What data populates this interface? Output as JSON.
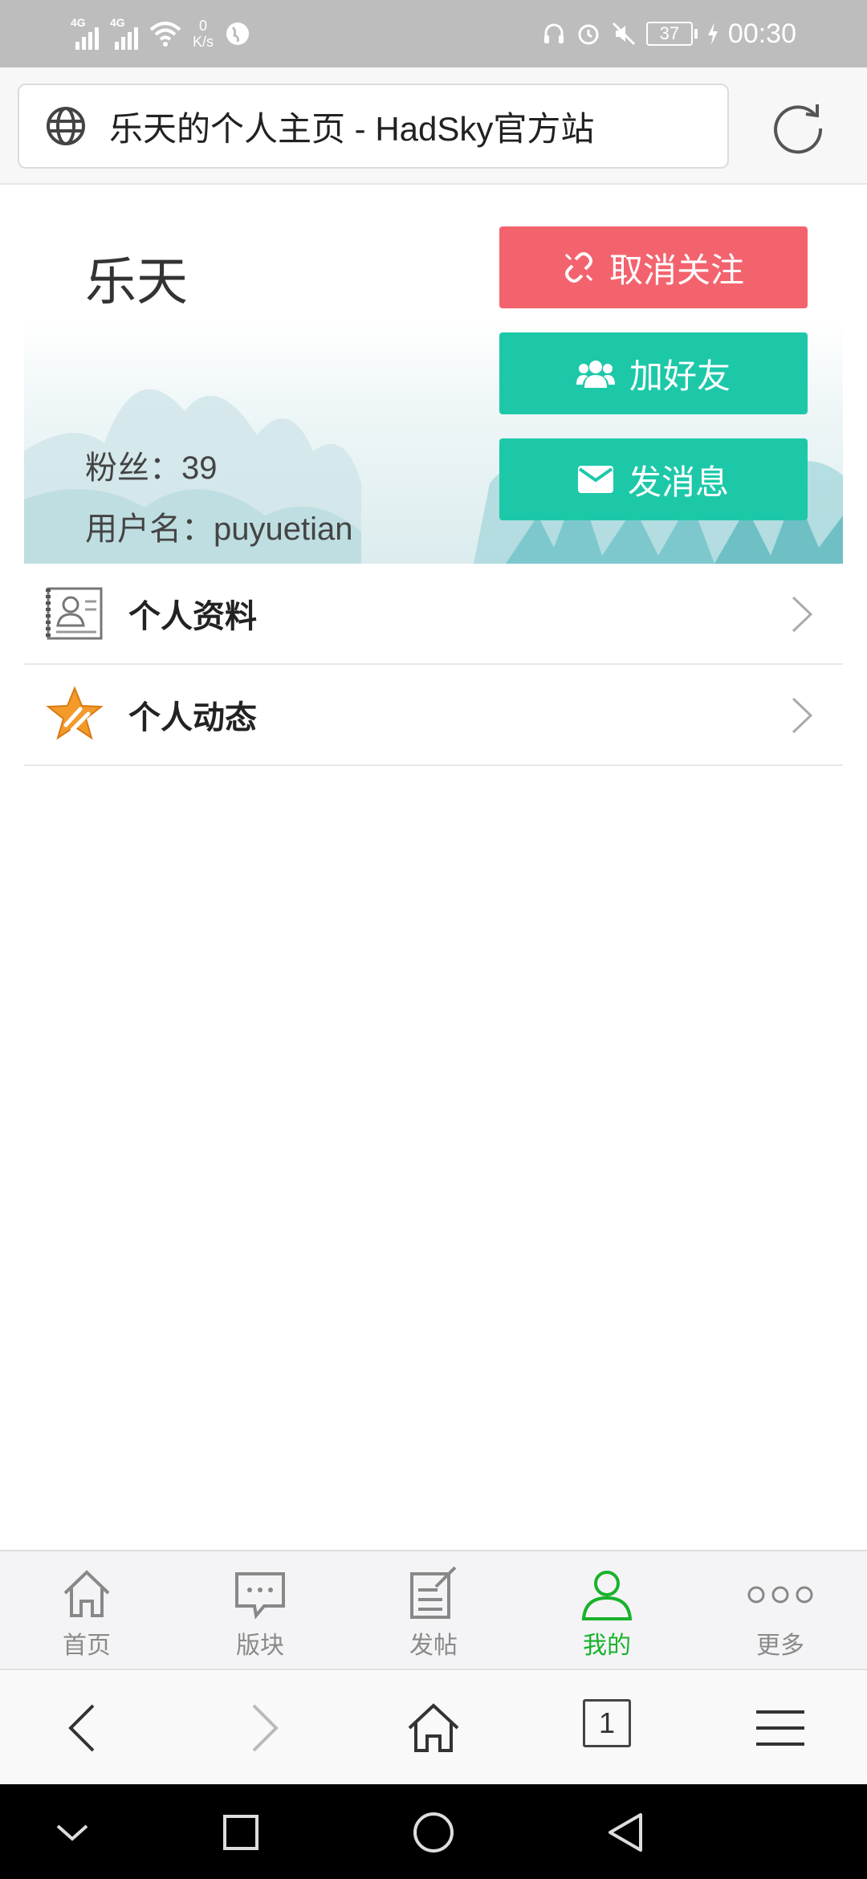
{
  "status_bar": {
    "net1": "4G",
    "net2": "4G",
    "speed_value": "0",
    "speed_unit": "K/s",
    "battery": "37",
    "time": "00:30"
  },
  "address_bar": {
    "title": "乐天的个人主页 - HadSky官方站"
  },
  "profile": {
    "name": "乐天",
    "fans": "粉丝：39",
    "username": "用户名：puyuetian",
    "buttons": {
      "unfollow": "取消关注",
      "add_friend": "加好友",
      "send_message": "发消息"
    },
    "colors": {
      "unfollow": "#f3636e",
      "primary": "#1dc8a9"
    }
  },
  "menu": {
    "items": [
      {
        "label": "个人资料",
        "icon": "profile-card-icon"
      },
      {
        "label": "个人动态",
        "icon": "star-icon"
      }
    ]
  },
  "tabbar": {
    "items": [
      {
        "label": "首页",
        "icon": "home-icon"
      },
      {
        "label": "版块",
        "icon": "chat-bubble-icon"
      },
      {
        "label": "发帖",
        "icon": "edit-post-icon"
      },
      {
        "label": "我的",
        "icon": "user-icon",
        "active": true
      },
      {
        "label": "更多",
        "icon": "more-dots-icon"
      }
    ],
    "active_color": "#19b22b"
  },
  "browser_nav": {
    "tab_count": "1"
  }
}
